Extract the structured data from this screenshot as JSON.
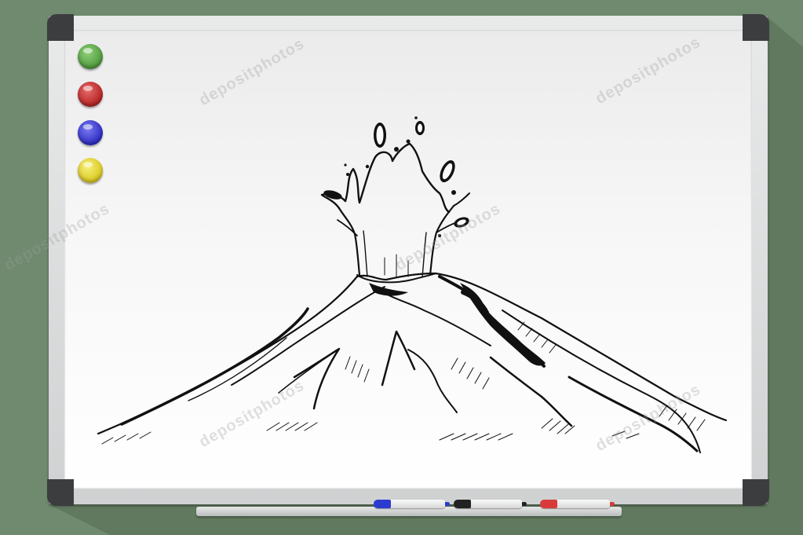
{
  "scene": {
    "description_label": "",
    "colors": {
      "background": "#6f8a6e",
      "frame": "#dcdedf",
      "corner": "#3b3d3e",
      "ink": "#111111"
    },
    "magnets": [
      {
        "name": "green-magnet",
        "color": "#4f9a3c"
      },
      {
        "name": "red-magnet",
        "color": "#b52424"
      },
      {
        "name": "blue-magnet",
        "color": "#2d2dc4"
      },
      {
        "name": "yellow-magnet",
        "color": "#d9c81f"
      }
    ],
    "markers": [
      {
        "name": "blue-marker",
        "cap_color": "#2b3bd0"
      },
      {
        "name": "black-marker",
        "cap_color": "#222222"
      },
      {
        "name": "red-marker",
        "cap_color": "#d83a3a"
      }
    ],
    "watermark_text": "depositphotos"
  }
}
